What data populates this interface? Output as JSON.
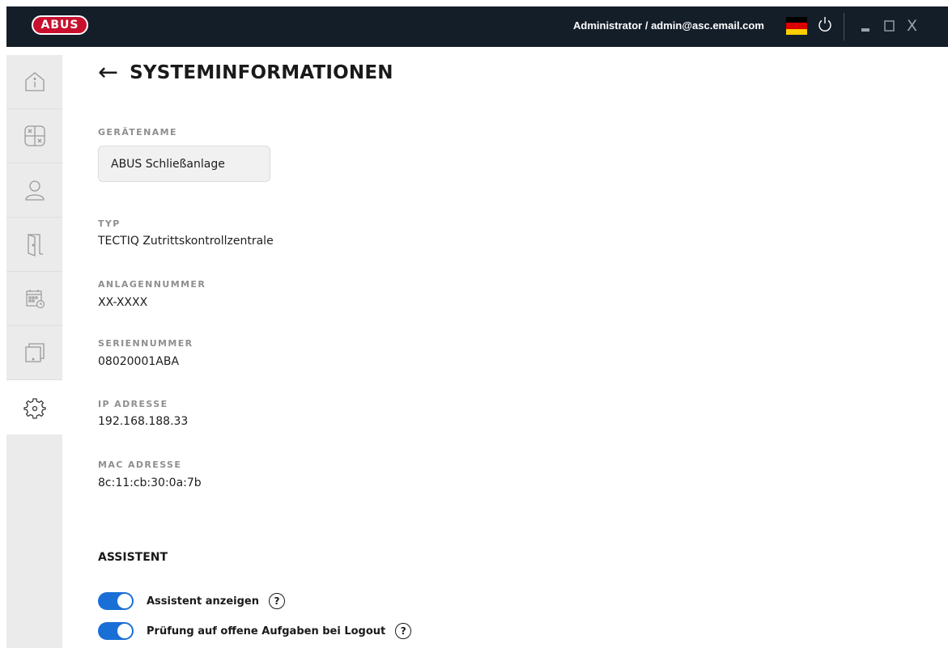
{
  "topbar": {
    "logo_text": "ABUS",
    "user_label": "Administrator / admin@asc.email.com",
    "flag_colors": [
      "#000000",
      "#dd0000",
      "#ffce00"
    ],
    "icons": [
      "power-icon",
      "minimize-icon",
      "maximize-icon",
      "close-icon"
    ],
    "close_glyph": "X"
  },
  "sidebar": {
    "items": [
      {
        "icon": "info-icon",
        "active": false
      },
      {
        "icon": "calculator-icon",
        "active": false
      },
      {
        "icon": "user-icon",
        "active": false
      },
      {
        "icon": "door-icon",
        "active": false
      },
      {
        "icon": "calendar-icon",
        "active": false
      },
      {
        "icon": "device-icon",
        "active": false
      },
      {
        "icon": "gear-icon",
        "active": true
      }
    ]
  },
  "page": {
    "back_arrow": "←",
    "title": "SYSTEMINFORMATIONEN"
  },
  "fields": {
    "device_name_label": "GERÄTENAME",
    "device_name_value": "ABUS Schließanlage",
    "type_label": "TYP",
    "type_value": "TECTIQ Zutrittskontrollzentrale",
    "system_number_label": "ANLAGENNUMMER",
    "system_number_value": "XX-XXXX",
    "serial_label": "SERIENNUMMER",
    "serial_value": "08020001ABA",
    "ip_label": "IP ADRESSE",
    "ip_value": "192.168.188.33",
    "mac_label": "MAC ADRESSE",
    "mac_value": "8c:11:cb:30:0a:7b"
  },
  "assistant": {
    "title": "ASSISTENT",
    "toggles": [
      {
        "label": "Assistent anzeigen",
        "on": true,
        "help": "?"
      },
      {
        "label": "Prüfung auf offene Aufgaben bei Logout",
        "on": true,
        "help": "?"
      }
    ]
  },
  "colors": {
    "topbar_bg": "#141e29",
    "logo_red": "#c8102e",
    "toggle_blue": "#1a6fd6",
    "sidebar_bg": "#ebebeb"
  }
}
